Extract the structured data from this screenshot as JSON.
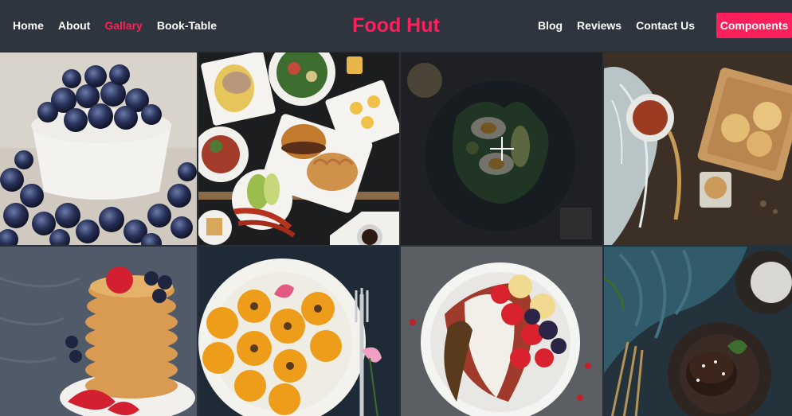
{
  "nav": {
    "left_links": [
      "Home",
      "About",
      "Gallary",
      "Book-Table"
    ],
    "active_link": "Gallary",
    "brand": "Food Hut",
    "right_links": [
      "Blog",
      "Reviews",
      "Contact Us"
    ],
    "cta_label": "Components"
  },
  "colors": {
    "nav_bg": "#2f353e",
    "accent": "#ff1f5a",
    "link": "#ffffff"
  },
  "gallery": {
    "hovered_tile_icon": "plus-icon",
    "tiles": [
      {
        "name": "blueberries-tile",
        "subject": "blueberries"
      },
      {
        "name": "burger-spread-tile",
        "subject": "burger-spread"
      },
      {
        "name": "egg-salad-tile",
        "subject": "egg-salad",
        "hovered": true
      },
      {
        "name": "tea-biscuits-tile",
        "subject": "tea-biscuits"
      },
      {
        "name": "pancakes-tile",
        "subject": "pancakes"
      },
      {
        "name": "citrus-plate-tile",
        "subject": "citrus-plate"
      },
      {
        "name": "smoothie-bowl-tile",
        "subject": "smoothie-bowl"
      },
      {
        "name": "chocolate-cake-tile",
        "subject": "chocolate-cake"
      }
    ]
  }
}
